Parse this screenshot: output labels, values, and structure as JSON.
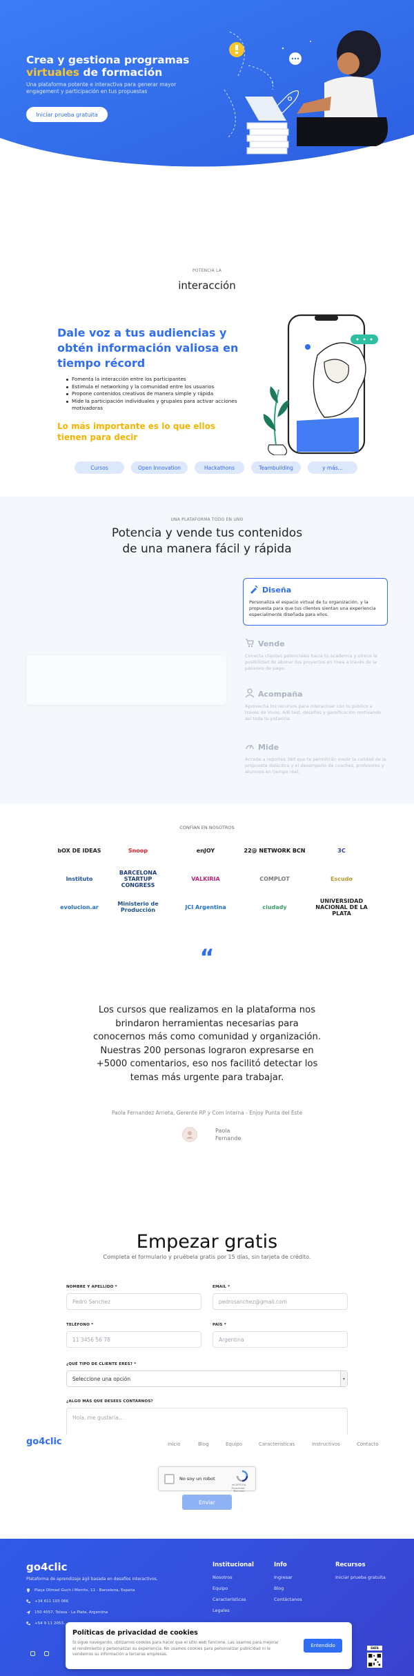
{
  "hero": {
    "title_line1": "Crea y gestiona programas",
    "title_highlight": "virtuales",
    "title_rest": " de formación",
    "description": "Una plataforma potente e interactiva para generar mayor engagement y participación en tus propuestas",
    "cta": "Iniciar prueba gratuita"
  },
  "interaction": {
    "eyebrow": "POTENCIA LA",
    "title": "interacción",
    "headline": "Dale voz a tus audiencias y obtén información valiosa en tiempo récord",
    "bullets": [
      "Fomenta la interacción entre los participantes",
      "Estimula el networking y la comunidad entre los usuarios",
      "Propone contenidos creativos de manera simple y rápida",
      "Mide la participación individuales y grupales para activar acciones motivadoras"
    ],
    "tagline": "Lo más importante es lo que ellos tienen para decir",
    "pills": [
      "Cursos",
      "Open Innovation",
      "Hackathons",
      "Teambuilding",
      "y más..."
    ]
  },
  "platform": {
    "eyebrow": "UNA PLATAFORMA TODO EN UNO",
    "title_line1": "Potencia y vende tus contenidos",
    "title_line2": "de una manera fácil y rápida",
    "features": [
      {
        "title": "Diseña",
        "description": "Personaliza el espacio virtual de tu organización, y la propuesta para que tus clientes sientan una experiencia especialmente diseñada para ellos.",
        "icon": "design-icon"
      },
      {
        "title": "Vende",
        "description": "Conecta clientes potenciales hacia tu academia y ofrece la posibilidad de abonar tus proyectos en línea a través de la pasarela de pago.",
        "icon": "cart-icon"
      },
      {
        "title": "Acompaña",
        "description": "Aprovecha los recursos para interactuar con tu público a través de Vivos, A/B test, desafíos y gamificación motivando así toda tu potencia.",
        "icon": "person-icon"
      },
      {
        "title": "Mide",
        "description": "Accede a reportes 360 que te permitirán medir la calidad de la propuesta didáctica y el desempeño de coaches, profesores y alumnos en tiempo real.",
        "icon": "gauge-icon"
      }
    ]
  },
  "clients": {
    "label": "CONFÍAN EN NOSOTROS",
    "logos": [
      {
        "name": "bOX DE IDEAS",
        "color": "#222222"
      },
      {
        "name": "Snoop",
        "color": "#d81f2a"
      },
      {
        "name": "enJOY",
        "color": "#1d1d1d"
      },
      {
        "name": "22@ NETWORK BCN",
        "color": "#111111"
      },
      {
        "name": "3C",
        "color": "#2a3b8f"
      },
      {
        "name": "Instituto",
        "color": "#1f4fa0"
      },
      {
        "name": "BARCELONA STARTUP CONGRESS",
        "color": "#1d3c78"
      },
      {
        "name": "VALKIRIA",
        "color": "#c0267a"
      },
      {
        "name": "COMPLOT",
        "color": "#7a7a7a"
      },
      {
        "name": "Escudo",
        "color": "#b89a2a"
      },
      {
        "name": "evolucion.ar",
        "color": "#1e6fc9"
      },
      {
        "name": "Ministerio de Producción",
        "color": "#1b4f8a"
      },
      {
        "name": "JCI Argentina",
        "color": "#1b6fd0"
      },
      {
        "name": "ciudady",
        "color": "#3aa06a"
      },
      {
        "name": "UNIVERSIDAD NACIONAL DE LA PLATA",
        "color": "#222222"
      }
    ]
  },
  "testimonial": {
    "quote": "Los cursos que realizamos en la plataforma nos brindaron herramientas necesarias para conocernos más como comunidad y organización. Nuestras 200 personas lograron expresarse en +5000 comentarios, eso nos facilitó detectar los temas más urgente para trabajar.",
    "author": "Paola Fernandez Arrieta, Gerente RP y Com Interna - Enjoy Punta del Este",
    "first_name": "Paola",
    "last_name": "Fernande"
  },
  "form": {
    "title": "Empezar gratis",
    "subtitle": "Completa el formulario y pruébela gratis por 15 días, sin tarjeta de crédito.",
    "name_label": "NOMBRE Y APELLIDO *",
    "name_placeholder": "Pedro Sanchez",
    "email_label": "EMAIL *",
    "email_placeholder": "pedrosanchez@gmail.com",
    "phone_label": "TELÉFONO *",
    "phone_placeholder": "11 3456 56 78",
    "country_label": "PAÍS *",
    "country_placeholder": "Argentina",
    "client_type_label": "¿QUÉ TIPO DE CLIENTE ERES? *",
    "client_type_value": "Seleccione una opción",
    "message_label": "¿ALGO MÁS QUE DESEES CONTARNOS?",
    "message_placeholder": "Hola, me gustaría...",
    "recaptcha_text": "No soy un robot",
    "recaptcha_legal": "reCAPTCHA Privacidad · Términos",
    "submit": "Enviar"
  },
  "nav": {
    "logo": "go4clic",
    "items": [
      "Inicio",
      "Blog",
      "Equipo",
      "Características",
      "Instructivos",
      "Contacto"
    ]
  },
  "footer": {
    "logo": "go4clic",
    "description": "Plataforma de aprendizaje ágil basada en desafíos interactivos.",
    "contacts": [
      "Plaça Olímed Guch i Morrits, 11 - Barcelona, España",
      "+34 611 103 086",
      "150 4557, Tolosa - La Plata, Argentina",
      "+54 9 11 2053..."
    ],
    "columns": [
      {
        "title": "Institucional",
        "links": [
          "Nosotros",
          "Equipo",
          "Características",
          "Legales"
        ]
      },
      {
        "title": "Info",
        "links": [
          "Ingresar",
          "Blog",
          "Contáctanos"
        ]
      },
      {
        "title": "Recursos",
        "links": [
          "Iniciar prueba gratuita"
        ]
      }
    ],
    "qr_label": "DATA"
  },
  "cookies": {
    "title": "Políticas de privacidad de cookies",
    "text": "Si sigue navegando, utilizamos cookies para hacer que el sitio web funcione. Las usamos para mejorar el rendimiento y personalizar su experiencia. No usamos cookies para personalizar publicidad ni le vendemos su información a terceras empresas.",
    "accept": "Entendido"
  },
  "colors": {
    "primary": "#2f6df2",
    "accent": "#f7c52b",
    "footer": "#3448dc"
  }
}
